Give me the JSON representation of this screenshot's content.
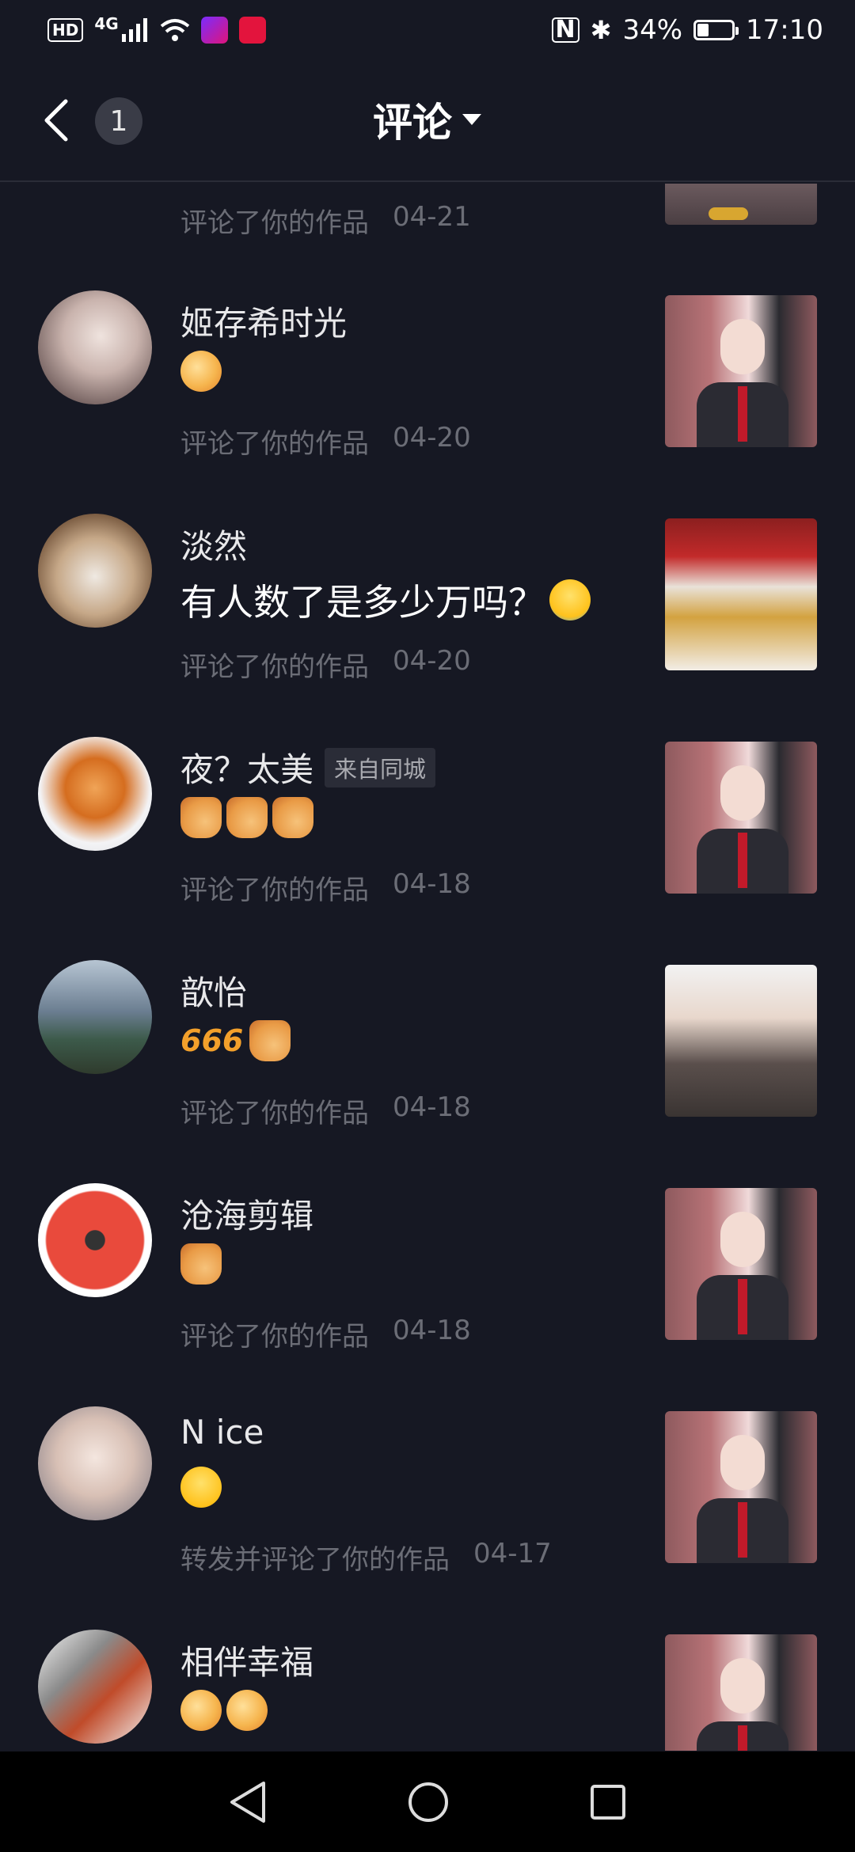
{
  "status_bar": {
    "hd": "HD",
    "network": "4G",
    "battery_percent": "34%",
    "time": "17:10",
    "battery_level": 0.34
  },
  "header": {
    "back_icon": "chevron-left-icon",
    "badge_count": "1",
    "title": "评论",
    "dropdown_icon": "caret-down-icon"
  },
  "partial_item": {
    "meta": "评论了你的作品",
    "date": "04-21"
  },
  "items": [
    {
      "name": "姬存希时光",
      "tag": "",
      "comment_text": "",
      "emojis": [
        "clap"
      ],
      "meta": "评论了你的作品",
      "date": "04-20",
      "thumb": "court"
    },
    {
      "name": "淡然",
      "tag": "",
      "comment_text": "有人数了是多少万吗？",
      "emojis": [
        "laugh-cry"
      ],
      "meta": "评论了你的作品",
      "date": "04-20",
      "thumb": "banner"
    },
    {
      "name": "夜？太美",
      "tag": "来自同城",
      "comment_text": "",
      "emojis": [
        "thumbs-up",
        "thumbs-up",
        "thumbs-up"
      ],
      "meta": "评论了你的作品",
      "date": "04-18",
      "thumb": "court"
    },
    {
      "name": "歆怡",
      "tag": "",
      "comment_text": "",
      "emojis": [
        "666",
        "thumbs-up"
      ],
      "meta": "评论了你的作品",
      "date": "04-18",
      "thumb": "portrait"
    },
    {
      "name": "沧海剪辑",
      "tag": "",
      "comment_text": "",
      "emojis": [
        "thumbs-up"
      ],
      "meta": "评论了你的作品",
      "date": "04-18",
      "thumb": "court"
    },
    {
      "name": "N ice",
      "tag": "",
      "comment_text": "",
      "emojis": [
        "grin"
      ],
      "meta": "转发并评论了你的作品",
      "date": "04-17",
      "thumb": "court"
    },
    {
      "name": "相伴幸福",
      "tag": "",
      "comment_text": "",
      "emojis": [
        "clap",
        "clap"
      ],
      "meta": "",
      "date": "",
      "thumb": "court"
    }
  ],
  "colors": {
    "background": "#161823",
    "text_primary": "#ffffff",
    "text_secondary": "#6b6d76"
  },
  "nav_bar": {
    "back": "triangle-back-icon",
    "home": "circle-home-icon",
    "recents": "square-recents-icon"
  }
}
